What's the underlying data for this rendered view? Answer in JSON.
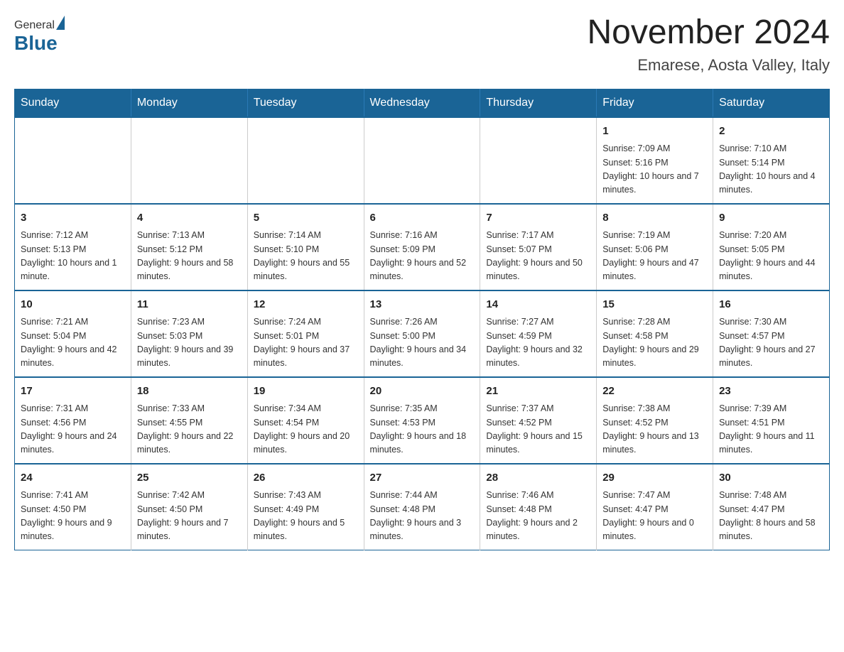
{
  "header": {
    "logo": {
      "general": "General",
      "blue": "Blue"
    },
    "title": "November 2024",
    "location": "Emarese, Aosta Valley, Italy"
  },
  "weekdays": [
    "Sunday",
    "Monday",
    "Tuesday",
    "Wednesday",
    "Thursday",
    "Friday",
    "Saturday"
  ],
  "weeks": [
    [
      {
        "day": "",
        "info": ""
      },
      {
        "day": "",
        "info": ""
      },
      {
        "day": "",
        "info": ""
      },
      {
        "day": "",
        "info": ""
      },
      {
        "day": "",
        "info": ""
      },
      {
        "day": "1",
        "info": "Sunrise: 7:09 AM\nSunset: 5:16 PM\nDaylight: 10 hours and 7 minutes."
      },
      {
        "day": "2",
        "info": "Sunrise: 7:10 AM\nSunset: 5:14 PM\nDaylight: 10 hours and 4 minutes."
      }
    ],
    [
      {
        "day": "3",
        "info": "Sunrise: 7:12 AM\nSunset: 5:13 PM\nDaylight: 10 hours and 1 minute."
      },
      {
        "day": "4",
        "info": "Sunrise: 7:13 AM\nSunset: 5:12 PM\nDaylight: 9 hours and 58 minutes."
      },
      {
        "day": "5",
        "info": "Sunrise: 7:14 AM\nSunset: 5:10 PM\nDaylight: 9 hours and 55 minutes."
      },
      {
        "day": "6",
        "info": "Sunrise: 7:16 AM\nSunset: 5:09 PM\nDaylight: 9 hours and 52 minutes."
      },
      {
        "day": "7",
        "info": "Sunrise: 7:17 AM\nSunset: 5:07 PM\nDaylight: 9 hours and 50 minutes."
      },
      {
        "day": "8",
        "info": "Sunrise: 7:19 AM\nSunset: 5:06 PM\nDaylight: 9 hours and 47 minutes."
      },
      {
        "day": "9",
        "info": "Sunrise: 7:20 AM\nSunset: 5:05 PM\nDaylight: 9 hours and 44 minutes."
      }
    ],
    [
      {
        "day": "10",
        "info": "Sunrise: 7:21 AM\nSunset: 5:04 PM\nDaylight: 9 hours and 42 minutes."
      },
      {
        "day": "11",
        "info": "Sunrise: 7:23 AM\nSunset: 5:03 PM\nDaylight: 9 hours and 39 minutes."
      },
      {
        "day": "12",
        "info": "Sunrise: 7:24 AM\nSunset: 5:01 PM\nDaylight: 9 hours and 37 minutes."
      },
      {
        "day": "13",
        "info": "Sunrise: 7:26 AM\nSunset: 5:00 PM\nDaylight: 9 hours and 34 minutes."
      },
      {
        "day": "14",
        "info": "Sunrise: 7:27 AM\nSunset: 4:59 PM\nDaylight: 9 hours and 32 minutes."
      },
      {
        "day": "15",
        "info": "Sunrise: 7:28 AM\nSunset: 4:58 PM\nDaylight: 9 hours and 29 minutes."
      },
      {
        "day": "16",
        "info": "Sunrise: 7:30 AM\nSunset: 4:57 PM\nDaylight: 9 hours and 27 minutes."
      }
    ],
    [
      {
        "day": "17",
        "info": "Sunrise: 7:31 AM\nSunset: 4:56 PM\nDaylight: 9 hours and 24 minutes."
      },
      {
        "day": "18",
        "info": "Sunrise: 7:33 AM\nSunset: 4:55 PM\nDaylight: 9 hours and 22 minutes."
      },
      {
        "day": "19",
        "info": "Sunrise: 7:34 AM\nSunset: 4:54 PM\nDaylight: 9 hours and 20 minutes."
      },
      {
        "day": "20",
        "info": "Sunrise: 7:35 AM\nSunset: 4:53 PM\nDaylight: 9 hours and 18 minutes."
      },
      {
        "day": "21",
        "info": "Sunrise: 7:37 AM\nSunset: 4:52 PM\nDaylight: 9 hours and 15 minutes."
      },
      {
        "day": "22",
        "info": "Sunrise: 7:38 AM\nSunset: 4:52 PM\nDaylight: 9 hours and 13 minutes."
      },
      {
        "day": "23",
        "info": "Sunrise: 7:39 AM\nSunset: 4:51 PM\nDaylight: 9 hours and 11 minutes."
      }
    ],
    [
      {
        "day": "24",
        "info": "Sunrise: 7:41 AM\nSunset: 4:50 PM\nDaylight: 9 hours and 9 minutes."
      },
      {
        "day": "25",
        "info": "Sunrise: 7:42 AM\nSunset: 4:50 PM\nDaylight: 9 hours and 7 minutes."
      },
      {
        "day": "26",
        "info": "Sunrise: 7:43 AM\nSunset: 4:49 PM\nDaylight: 9 hours and 5 minutes."
      },
      {
        "day": "27",
        "info": "Sunrise: 7:44 AM\nSunset: 4:48 PM\nDaylight: 9 hours and 3 minutes."
      },
      {
        "day": "28",
        "info": "Sunrise: 7:46 AM\nSunset: 4:48 PM\nDaylight: 9 hours and 2 minutes."
      },
      {
        "day": "29",
        "info": "Sunrise: 7:47 AM\nSunset: 4:47 PM\nDaylight: 9 hours and 0 minutes."
      },
      {
        "day": "30",
        "info": "Sunrise: 7:48 AM\nSunset: 4:47 PM\nDaylight: 8 hours and 58 minutes."
      }
    ]
  ]
}
